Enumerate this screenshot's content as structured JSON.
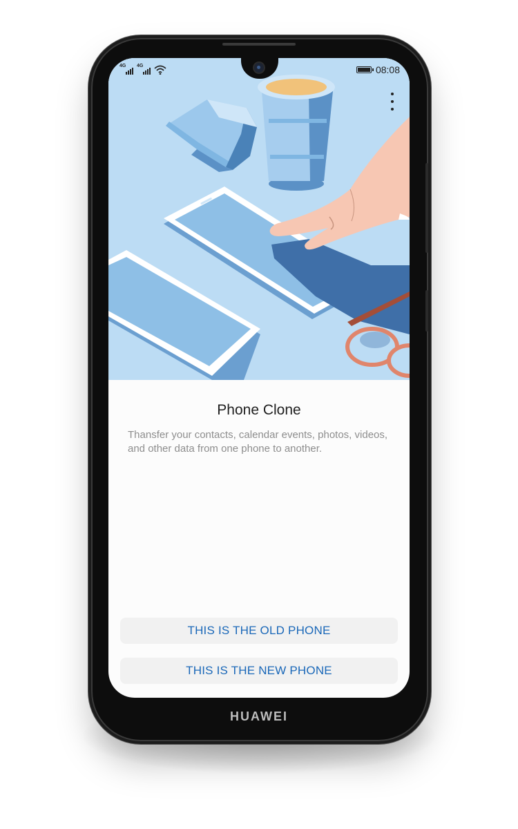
{
  "device": {
    "brand": "HUAWEI"
  },
  "status_bar": {
    "sim1_network": "4G",
    "sim2_network": "4G",
    "time": "08:08",
    "icons": [
      "signal-icon",
      "signal-icon",
      "wifi-icon",
      "battery-icon"
    ]
  },
  "toolbar": {
    "more_icon": "more-vertical-icon"
  },
  "content": {
    "title": "Phone Clone",
    "description": "Thansfer your contacts, calendar events, photos, videos, and other data from one phone to another."
  },
  "actions": {
    "old_phone_label": "THIS IS THE OLD PHONE",
    "new_phone_label": "THIS IS THE NEW PHONE"
  },
  "colors": {
    "accent": "#1967b8",
    "hero_background": "#bcdcf4",
    "button_background": "#f1f1f1"
  }
}
